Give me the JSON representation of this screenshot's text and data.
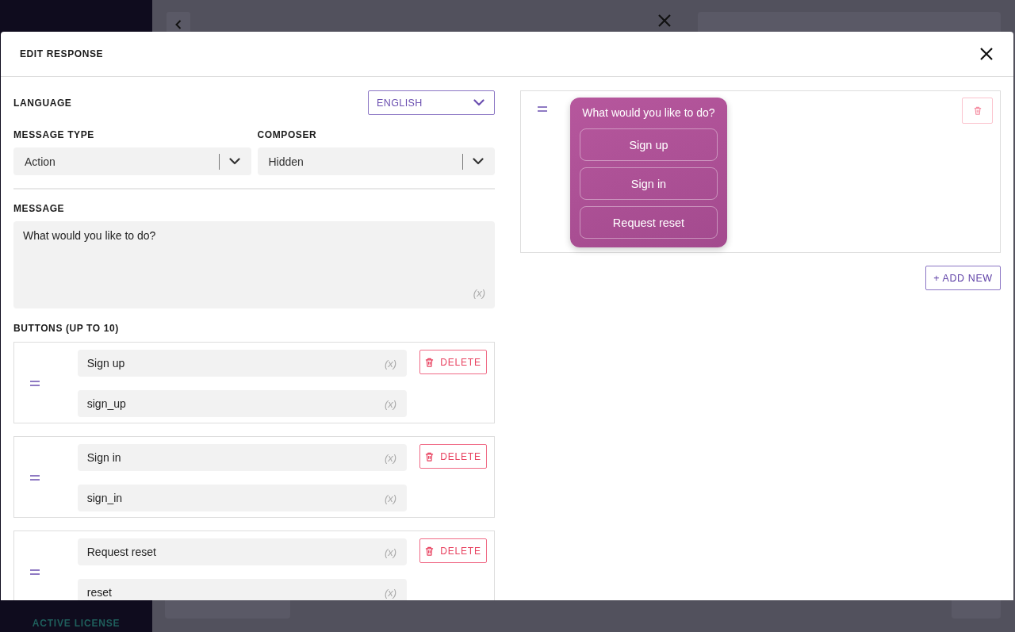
{
  "background": {
    "sidebar_footer": "ACTIVE LICENSE"
  },
  "modal": {
    "title": "EDIT RESPONSE"
  },
  "language": {
    "label": "LANGUAGE",
    "value": "ENGLISH"
  },
  "message_type": {
    "label": "MESSAGE TYPE",
    "value": "Action"
  },
  "composer": {
    "label": "COMPOSER",
    "value": "Hidden"
  },
  "message": {
    "label": "MESSAGE",
    "value": "What would you like to do?",
    "insert_icon": "(x)"
  },
  "buttons_section": {
    "label": "BUTTONS (UP TO 10)",
    "items": [
      {
        "title": "Sign up",
        "title_icon": "(x)",
        "payload": "sign_up",
        "payload_icon": "(x)",
        "delete": "DELETE"
      },
      {
        "title": "Sign in",
        "title_icon": "(x)",
        "payload": "sign_in",
        "payload_icon": "(x)",
        "delete": "DELETE"
      },
      {
        "title": "Request reset",
        "title_icon": "(x)",
        "payload": "reset",
        "payload_icon": "(x)",
        "delete": "DELETE"
      }
    ]
  },
  "preview": {
    "prompt": "What would you like to do?",
    "buttons": [
      "Sign up",
      "Sign in",
      "Request reset"
    ]
  },
  "add_new": "+ ADD NEW"
}
